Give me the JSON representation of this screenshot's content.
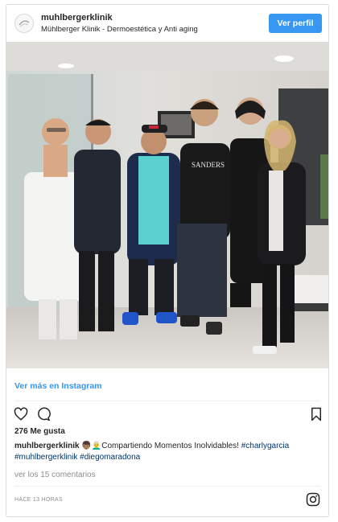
{
  "header": {
    "username": "muhlbergerklinik",
    "subtitle": "Mühlberger Klinik - Dermoestética y Anti aging",
    "view_profile_label": "Ver perfil"
  },
  "photo": {
    "signage_text": "SANDERS"
  },
  "view_more_label": "Ver más en Instagram",
  "actions": {
    "like_icon": "heart-icon",
    "comment_icon": "comment-icon",
    "save_icon": "bookmark-icon"
  },
  "likes_text": "276 Me gusta",
  "caption": {
    "username": "muhlbergerklinik",
    "emojis": "👦🏽👨‍🦳",
    "text": "Compartiendo Momentos Inolvidables!",
    "tag1": "#charlygarcia",
    "tag2": "#muhlbergerklinik",
    "tag3": "#diegomaradona"
  },
  "comments_link": "ver los 15 comentarios",
  "timestamp": "HACE 13 HORAS",
  "colors": {
    "accent": "#3897f0",
    "hashtag": "#003569",
    "muted": "#8e8e8e"
  }
}
